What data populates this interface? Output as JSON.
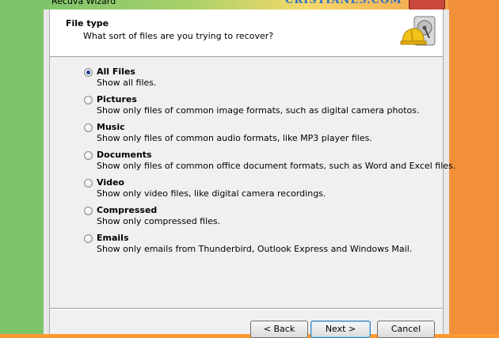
{
  "window": {
    "title": "Recuva Wizard",
    "watermark": "CRISTIANES.COM"
  },
  "header": {
    "title": "File type",
    "subtitle": "What sort of files are you trying to recover?"
  },
  "options": [
    {
      "label": "All Files",
      "desc": "Show all files.",
      "checked": true
    },
    {
      "label": "Pictures",
      "desc": "Show only files of common image formats, such as digital camera photos.",
      "checked": false
    },
    {
      "label": "Music",
      "desc": "Show only files of common audio formats, like MP3 player files.",
      "checked": false
    },
    {
      "label": "Documents",
      "desc": "Show only files of common office document formats, such as Word and Excel files.",
      "checked": false
    },
    {
      "label": "Video",
      "desc": "Show only video files, like digital camera recordings.",
      "checked": false
    },
    {
      "label": "Compressed",
      "desc": "Show only compressed files.",
      "checked": false
    },
    {
      "label": "Emails",
      "desc": "Show only emails from Thunderbird, Outlook Express and Windows Mail.",
      "checked": false
    }
  ],
  "buttons": {
    "back": "< Back",
    "next": "Next >",
    "cancel": "Cancel"
  },
  "colors": {
    "left_background": "#7ec46b",
    "right_background": "#f2903a",
    "radio_dot": "#1d3f8a",
    "watermark": "#2a6fc9"
  }
}
